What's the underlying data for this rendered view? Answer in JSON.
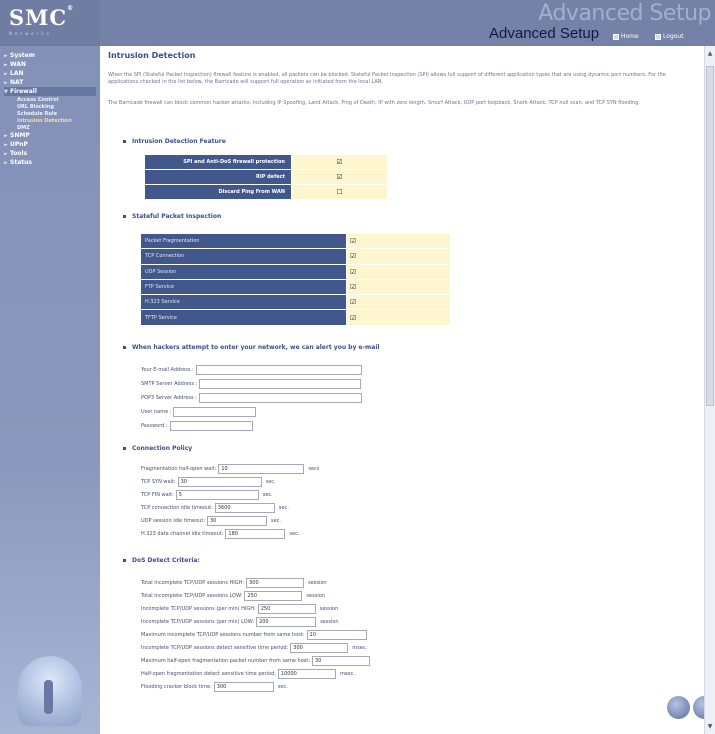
{
  "header": {
    "logo": "SMC",
    "logo_sup": "®",
    "logo_sub": "Networks",
    "watermark": "Advanced Setup",
    "title": "Advanced Setup",
    "home_label": "Home",
    "logout_label": "Logout"
  },
  "sidebar": {
    "items": [
      {
        "label": "System"
      },
      {
        "label": "WAN"
      },
      {
        "label": "LAN"
      },
      {
        "label": "NAT"
      },
      {
        "label": "Firewall"
      },
      {
        "label": "Access Control"
      },
      {
        "label": "URL Blocking"
      },
      {
        "label": "Schedule Rule"
      },
      {
        "label": "Intrusion Detection"
      },
      {
        "label": "DMZ"
      },
      {
        "label": "SNMP"
      },
      {
        "label": "UPnP"
      },
      {
        "label": "Tools"
      },
      {
        "label": "Status"
      }
    ]
  },
  "main": {
    "title": "Intrusion Detection",
    "para1": "When the SPI (Stateful Packet Inspection) firewall feature is enabled, all packets can be blocked. Stateful Packet Inspection (SPI) allows full support of different application types that are using dynamic port numbers. For the applications checked in the list below, the Barricade will support full operation as initiated from the local LAN.",
    "para2": "The Barricade firewall can block common hacker attacks, including IP Spoofing, Land Attack, Ping of Death, IP with zero length, Smurf Attack, UDP port loopback, Snork Attack, TCP null scan, and TCP SYN flooding.",
    "section_features": "Intrusion Detection Feature",
    "features": [
      {
        "label": "SPI and Anti-DoS firewall protection",
        "value": "☑"
      },
      {
        "label": "RIP defect",
        "value": "☑"
      },
      {
        "label": "Discard Ping From WAN",
        "value": "☐"
      }
    ],
    "section_spi": "Stateful Packet Inspection",
    "spi": [
      {
        "label": "Packet Fragmentation",
        "value": "☑"
      },
      {
        "label": "TCP Connection",
        "value": "☑"
      },
      {
        "label": "UDP Session",
        "value": "☑"
      },
      {
        "label": "FTP Service",
        "value": "☑"
      },
      {
        "label": "H.323 Service",
        "value": "☑"
      },
      {
        "label": "TFTP Service",
        "value": "☑"
      }
    ],
    "section_alert": "When hackers attempt to enter your network, we can alert you by e-mail",
    "alert": {
      "email_label": "Your E-mail Address :",
      "email_value": "",
      "smtp_label": "SMTP Server Address :",
      "smtp_value": "",
      "pop3_label": "POP3 Server Address :",
      "pop3_value": "",
      "user_label": "User name :",
      "user_value": "",
      "pass_label": "Password :",
      "pass_value": ""
    },
    "section_policy": "Connection Policy",
    "policy": [
      {
        "label": "Fragmentation half-open wait:",
        "value": "10",
        "unit": "secs"
      },
      {
        "label": "TCP SYN wait:",
        "value": "30",
        "unit": "sec."
      },
      {
        "label": "TCP FIN wait:",
        "value": "5",
        "unit": "sec."
      },
      {
        "label": "TCP connection idle timeout:",
        "value": "3600",
        "unit": "sec."
      },
      {
        "label": "UDP session idle timeout:",
        "value": "30",
        "unit": "sec."
      },
      {
        "label": "H.323 data channel idle timeout:",
        "value": "180",
        "unit": "sec."
      }
    ],
    "section_dos": "DoS Detect Criteria:",
    "dos": [
      {
        "label": "Total incomplete TCP/UDP sessions HIGH:",
        "value": "300",
        "unit": "session"
      },
      {
        "label": "Total incomplete TCP/UDP sessions LOW:",
        "value": "250",
        "unit": "session"
      },
      {
        "label": "Incomplete TCP/UDP sessions (per min) HIGH:",
        "value": "250",
        "unit": "session"
      },
      {
        "label": "Incomplete TCP/UDP sessions (per min) LOW:",
        "value": "200",
        "unit": "session"
      },
      {
        "label": "Maximum incomplete TCP/UDP sessions number from same host:",
        "value": "10",
        "unit": ""
      },
      {
        "label": "Incomplete TCP/UDP sessions detect sensitive time period:",
        "value": "300",
        "unit": "msec."
      },
      {
        "label": "Maximum half-open fragmentation packet number from same host:",
        "value": "30",
        "unit": ""
      },
      {
        "label": "Half-open fragmentation detect sensitive time period:",
        "value": "10000",
        "unit": "msec."
      },
      {
        "label": "Flooding cracker block time:",
        "value": "300",
        "unit": "sec."
      }
    ]
  }
}
